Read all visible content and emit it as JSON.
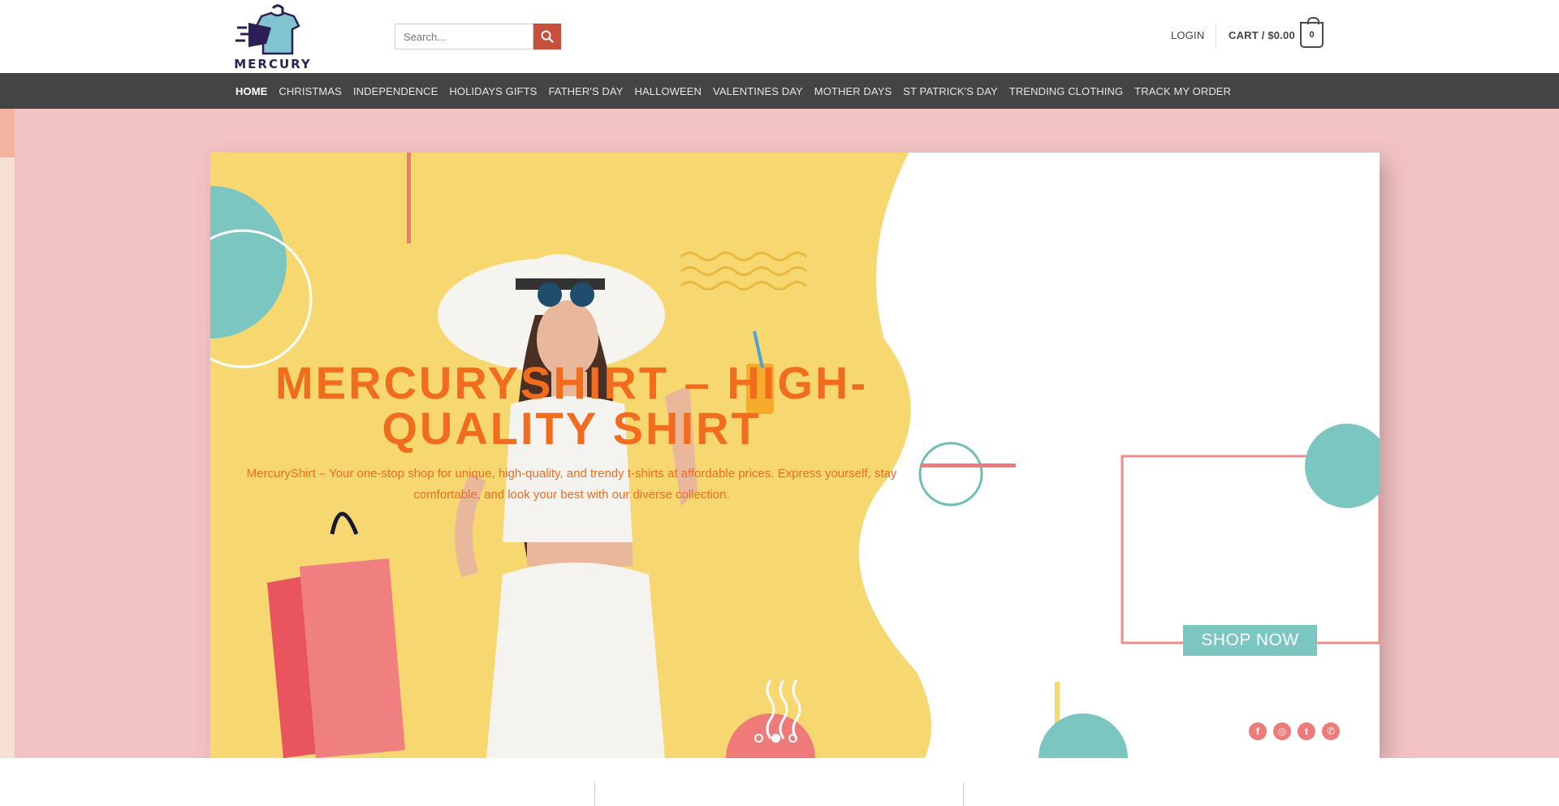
{
  "brand": {
    "name": "MERCURY"
  },
  "search": {
    "placeholder": "Search..."
  },
  "header": {
    "login_label": "LOGIN",
    "cart_label": "CART / $0.00",
    "cart_count": "0"
  },
  "nav": {
    "items": [
      {
        "label": "HOME",
        "active": true
      },
      {
        "label": "CHRISTMAS"
      },
      {
        "label": "INDEPENDENCE"
      },
      {
        "label": "HOLIDAYS GIFTS"
      },
      {
        "label": "FATHER'S DAY"
      },
      {
        "label": "HALLOWEEN"
      },
      {
        "label": "VALENTINES DAY"
      },
      {
        "label": "MOTHER DAYS"
      },
      {
        "label": "ST PATRICK'S DAY"
      },
      {
        "label": "TRENDING CLOTHING"
      },
      {
        "label": "TRACK MY ORDER"
      }
    ]
  },
  "hero": {
    "title": "MERCURYSHIRT – HIGH-QUALITY SHIRT",
    "subtitle": "MercuryShirt – Your one-stop shop for unique, high-quality, and trendy t-shirts at affordable prices. Express yourself, stay comfortable, and look your best with our diverse collection.",
    "cta_label": "SHOP NOW",
    "slides_total": 3,
    "slide_active": 2
  },
  "social": [
    "facebook-icon",
    "instagram-icon",
    "twitter-icon",
    "whatsapp-icon"
  ],
  "colors": {
    "nav_bg": "#444444",
    "hero_bg": "#f2c3c4",
    "accent_orange": "#f26c1d",
    "search_button": "#c8503a",
    "teal": "#7bc6c0",
    "yellow": "#f7d870",
    "coral": "#ef7a7a"
  }
}
